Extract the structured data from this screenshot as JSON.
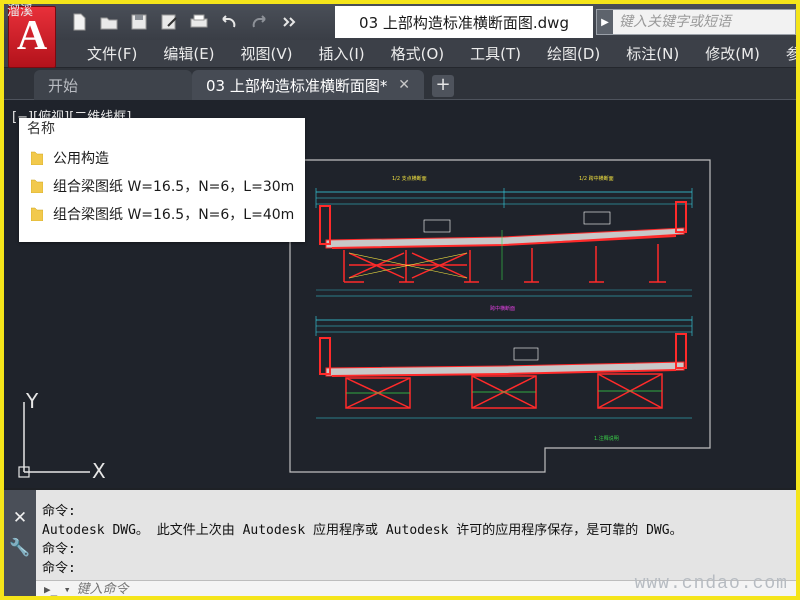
{
  "app": {
    "logo_letter": "A",
    "logo_watermark": "溜溪"
  },
  "titlebar": {
    "document_title": "03 上部构造标准横断面图.dwg",
    "search_placeholder": "键入关键字或短语",
    "quick_access": [
      {
        "name": "new-icon",
        "label": "新建"
      },
      {
        "name": "open-icon",
        "label": "打开"
      },
      {
        "name": "save-icon",
        "label": "保存"
      },
      {
        "name": "saveas-icon",
        "label": "另存为"
      },
      {
        "name": "print-icon",
        "label": "打印"
      },
      {
        "name": "undo-icon",
        "label": "放弃"
      },
      {
        "name": "redo-icon",
        "label": "重做"
      },
      {
        "name": "more-icon",
        "label": "更多"
      }
    ]
  },
  "menu": {
    "items": [
      "文件(F)",
      "编辑(E)",
      "视图(V)",
      "插入(I)",
      "格式(O)",
      "工具(T)",
      "绘图(D)",
      "标注(N)",
      "修改(M)",
      "参数"
    ]
  },
  "tabs": {
    "start": "开始",
    "active": "03 上部构造标准横断面图*",
    "close_glyph": "✕",
    "add_glyph": "+"
  },
  "viewport": {
    "view_label": "[−][俯视][二维线框]",
    "ucs_x": "X",
    "ucs_y": "Y"
  },
  "popup": {
    "header": "名称",
    "items": [
      "公用构造",
      "组合梁图纸 W=16.5，N=6，L=30m",
      "组合梁图纸 W=16.5，N=6，L=40m"
    ]
  },
  "command": {
    "lines": [
      "命令:",
      "Autodesk DWG。  此文件上次由 Autodesk 应用程序或 Autodesk 许可的应用程序保存，是可靠的 DWG。",
      "命令:",
      "命令:"
    ],
    "input_placeholder": "键入命令",
    "prompt_glyph": "▶_ ▾"
  },
  "watermark": "www.cndao.com",
  "colors": {
    "frame_border": "#f5e51a",
    "drawing_bg": "#1f232b",
    "accent_red": "#e0242c",
    "cad_red": "#ff2a2a",
    "cad_cyan": "#38d6e8",
    "cad_green": "#3ad64a",
    "cad_magenta": "#e040e0",
    "cad_yellow": "#f0e040"
  }
}
